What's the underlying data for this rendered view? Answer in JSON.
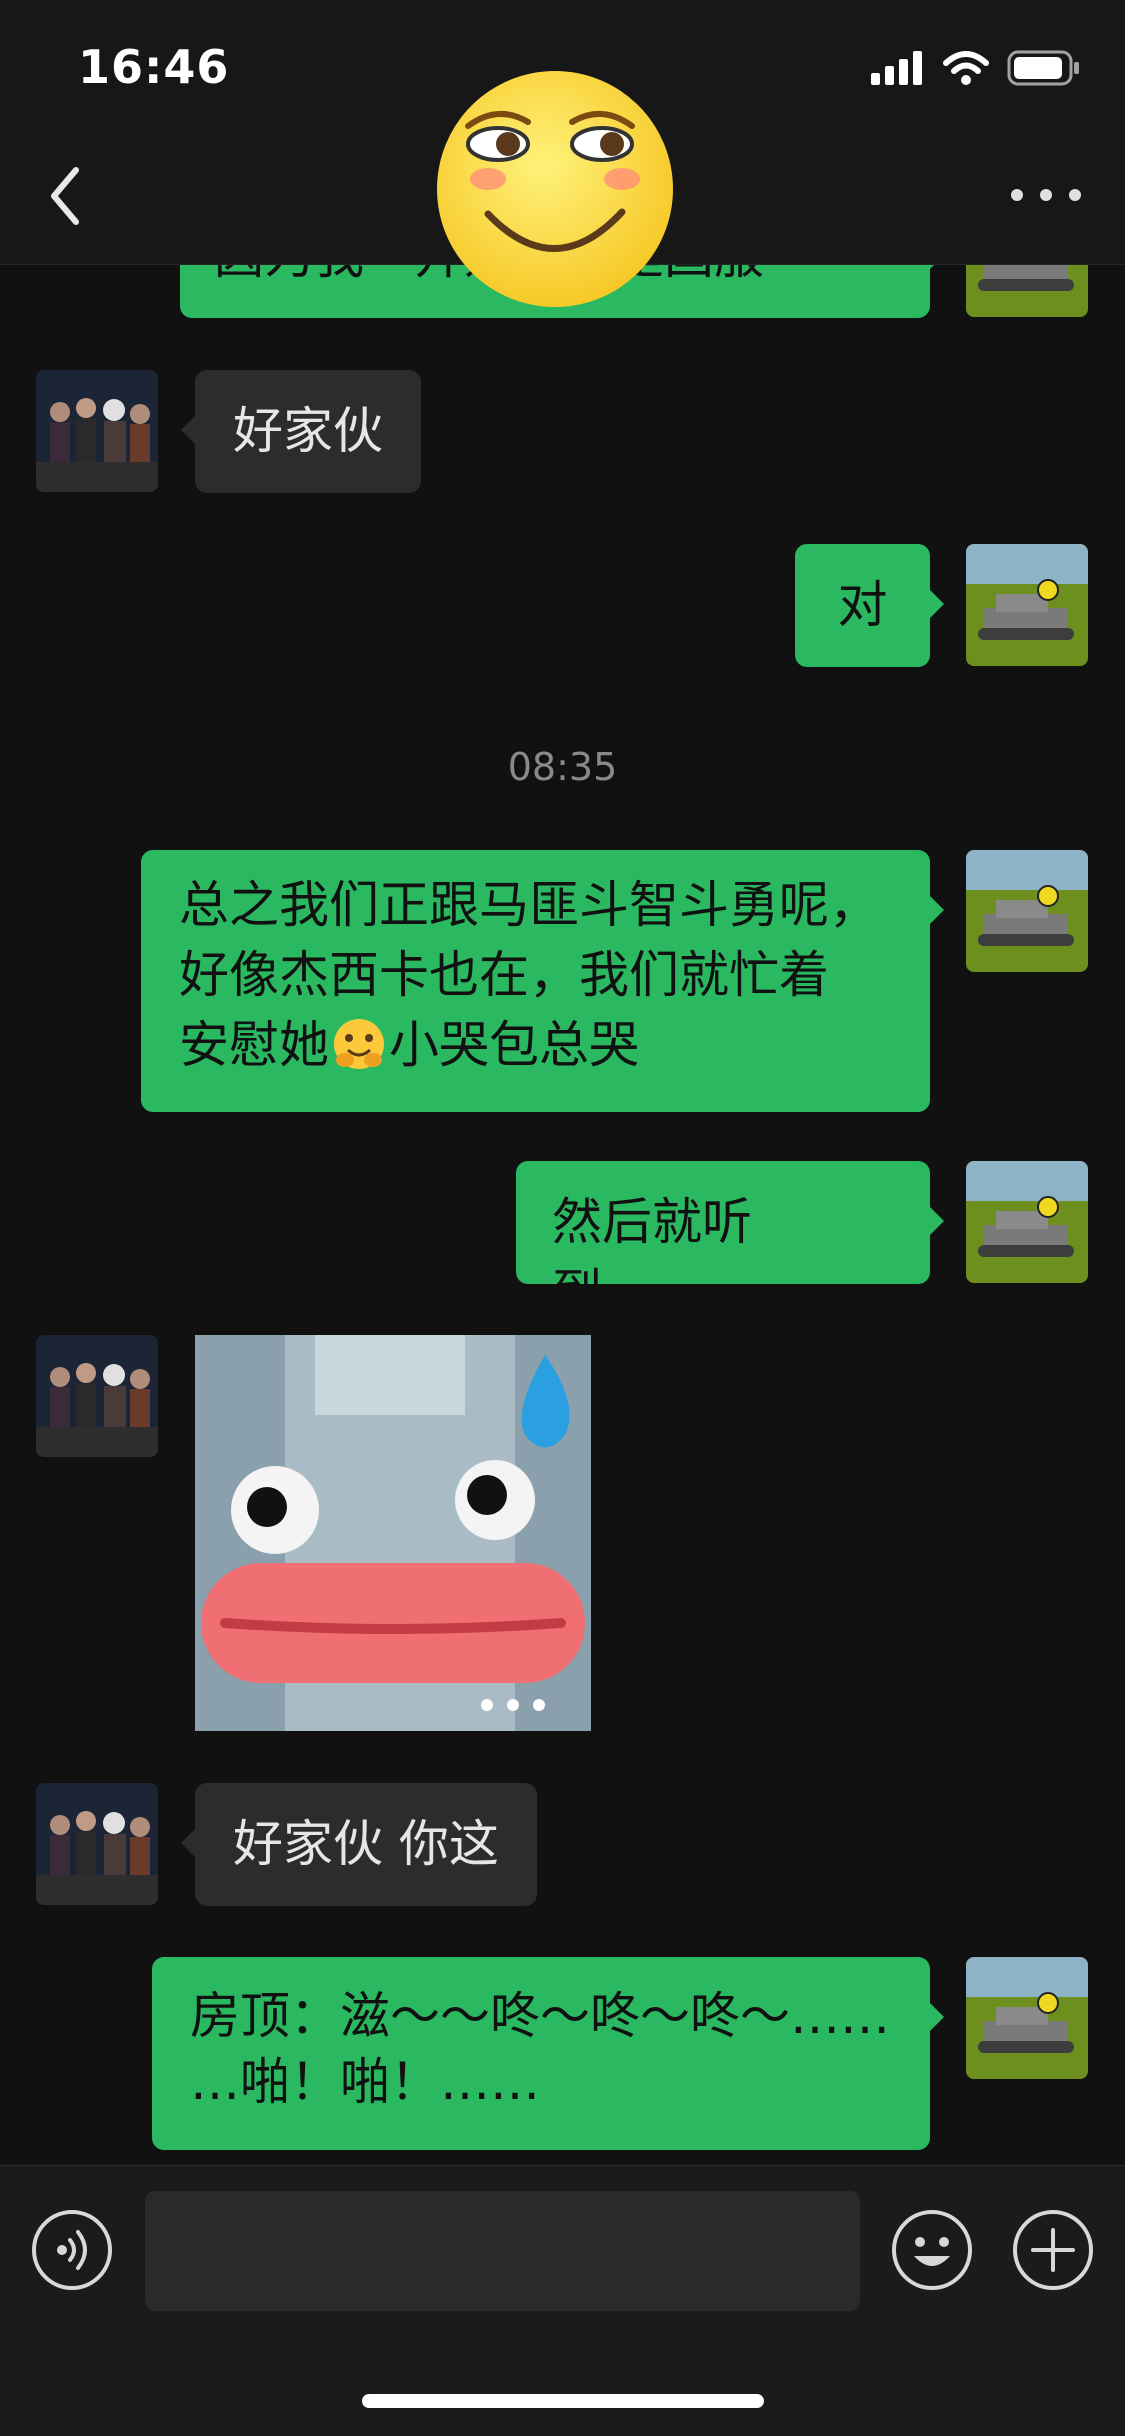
{
  "status_bar": {
    "time": "16:46",
    "battery_icon": "battery-icon",
    "wifi_icon": "wifi-icon",
    "signal_icon": "signal-icon"
  },
  "nav": {
    "back_icon": "chevron-left-icon",
    "more_icon": "more-icon",
    "overlay_sticker": "smirk-face-sticker"
  },
  "messages": [
    {
      "side": "out",
      "text": "因为我一开始应该是国服",
      "partial": true
    },
    {
      "side": "in",
      "text": "好家伙"
    },
    {
      "side": "out",
      "text": "对"
    },
    {
      "type": "timestamp",
      "text": "08:35"
    },
    {
      "side": "out",
      "lines": [
        "总之我们正跟马匪斗智斗勇呢，",
        "好像杰西卡也在，我们就忙着",
        "安慰她",
        "小哭包总哭"
      ],
      "emoji": "hugging-face-emoji"
    },
    {
      "side": "out",
      "text": "然后就听到……"
    },
    {
      "side": "in",
      "type": "sticker",
      "sticker": "bottle-lips-sweat-sticker"
    },
    {
      "side": "in",
      "text": "好家伙 你这"
    },
    {
      "side": "out",
      "lines": [
        "房顶：滋～～咚～咚～咚～……",
        "…啪！啪！……"
      ]
    }
  ],
  "colors": {
    "outgoing_bubble": "#2ab961",
    "incoming_bubble": "#2c2c2c",
    "background": "#111111",
    "timestamp": "#8a8a8a"
  },
  "input_bar": {
    "voice_icon": "voice-icon",
    "emoji_icon": "emoji-icon",
    "plus_icon": "plus-icon",
    "input_value": ""
  }
}
